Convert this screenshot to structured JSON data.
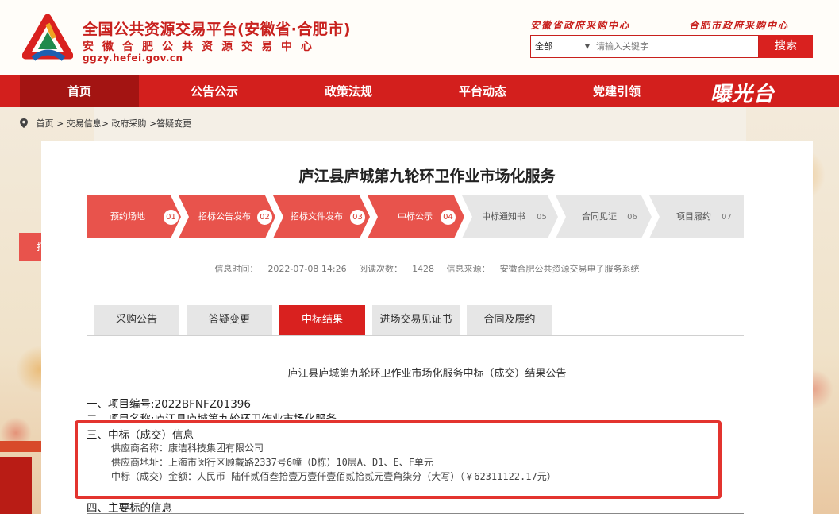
{
  "header": {
    "title": "全国公共资源交易平台(安徽省·合肥市)",
    "subtitle": "安徽合肥公共资源交易中心",
    "url": "ggzy.hefei.gov.cn",
    "link_province": "安徽省政府采购中心",
    "link_city": "合肥市政府采购中心",
    "search_scope": "全部",
    "search_placeholder": "请输入关键字",
    "search_button": "搜索"
  },
  "nav": {
    "items": [
      {
        "label": "首页",
        "active": true
      },
      {
        "label": "公告公示"
      },
      {
        "label": "政策法规"
      },
      {
        "label": "平台动态"
      },
      {
        "label": "党建引领"
      }
    ],
    "brand": "曝光台"
  },
  "breadcrumb": "首页 > 交易信息> 政府采购 >答疑变更",
  "page": {
    "title": "庐江县庐城第九轮环卫作业市场化服务",
    "print": "打印",
    "steps": [
      {
        "label": "预约场地",
        "num": "01",
        "active": true
      },
      {
        "label": "招标公告发布",
        "num": "02",
        "active": true
      },
      {
        "label": "招标文件发布",
        "num": "03",
        "active": true
      },
      {
        "label": "中标公示",
        "num": "04",
        "active": true
      },
      {
        "label": "中标通知书",
        "num": "05",
        "active": false
      },
      {
        "label": "合同见证",
        "num": "06",
        "active": false
      },
      {
        "label": "项目履约",
        "num": "07",
        "active": false
      }
    ],
    "meta": {
      "time_label": "信息时间：",
      "time": "2022-07-08 14:26",
      "views_label": "阅读次数：",
      "views": "1428",
      "source_label": "信息来源：",
      "source": "安徽合肥公共资源交易电子服务系统"
    },
    "tabs": [
      "采购公告",
      "答疑变更",
      "中标结果",
      "进场交易见证书",
      "合同及履约"
    ],
    "active_tab": "中标结果"
  },
  "content": {
    "announcement_title": "庐江县庐城第九轮环卫作业市场化服务中标（成交）结果公告",
    "sec1": "一、项目编号:2022BFNFZ01396",
    "sec2": "二、项目名称:庐江县庐城第九轮环卫作业市场化服务",
    "sec3": "三、中标（成交）信息",
    "supplier_name": "供应商名称：康洁科技集团有限公司",
    "supplier_addr": "供应商地址：上海市闵行区顾戴路2337号6幢（D栋）10层A、D1、E、F单元",
    "amount": "中标（成交）金额：人民币 陆仟贰佰叁拾壹万壹仟壹佰贰拾贰元壹角柒分（大写）（￥62311122.17元）",
    "sec4": "四、主要标的信息"
  },
  "colors": {
    "brand_red": "#d31f1d",
    "step_active": "#e8534c",
    "step_inactive": "#e6e6e6"
  }
}
